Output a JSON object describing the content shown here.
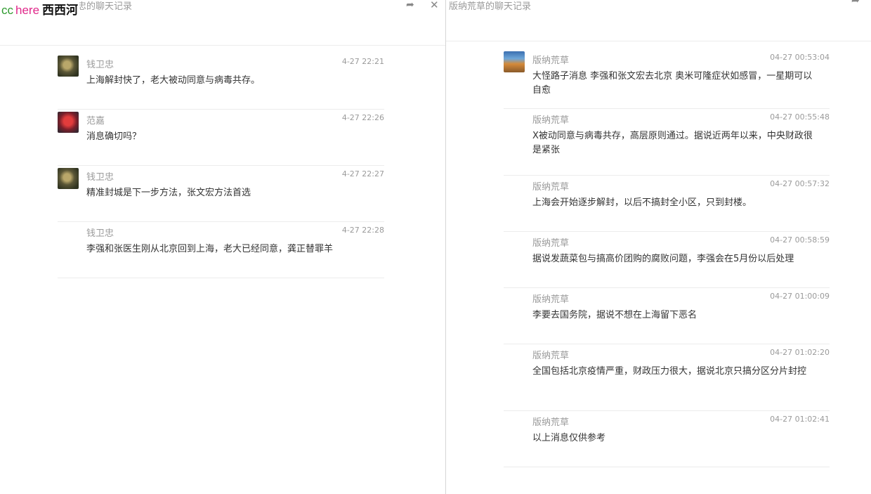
{
  "left": {
    "title": "钱卫忠的聊天记录",
    "title_visible": "忠的聊天记录",
    "watermark": {
      "cc": "cc",
      "here": "here",
      "name": "西西河"
    },
    "icons": {
      "share": "share-icon",
      "close": "close-icon"
    },
    "messages": [
      {
        "sender": "钱卫忠",
        "time": "4-27 22:21",
        "text": "上海解封快了，老大被动同意与病毒共存。",
        "avatar": "avatar-flower-yellow"
      },
      {
        "sender": "范嘉",
        "time": "4-27 22:26",
        "text": "消息确切吗？",
        "avatar": "avatar-flower-red"
      },
      {
        "sender": "钱卫忠",
        "time": "4-27 22:27",
        "text": "精准封城是下一步方法，张文宏方法首选",
        "avatar": "avatar-flower-yellow"
      },
      {
        "sender": "钱卫忠",
        "time": "4-27 22:28",
        "text": "李强和张医生刚从北京回到上海，老大已经同意，龚正替罪羊",
        "avatar": null
      }
    ]
  },
  "right": {
    "title": "版纳荒草的聊天记录",
    "icons": {
      "share": "share-icon"
    },
    "messages": [
      {
        "sender": "版纳荒草",
        "time": "04-27 00:53:04",
        "text": "大怪路子消息    李强和张文宏去北京     奥米可隆症状如感冒，一星期可以自愈",
        "avatar": "avatar-landscape"
      },
      {
        "sender": "版纳荒草",
        "time": "04-27 00:55:48",
        "text": "X被动同意与病毒共存，高层原则通过。据说近两年以来，中央财政很是紧张"
      },
      {
        "sender": "版纳荒草",
        "time": "04-27 00:57:32",
        "text": "上海会开始逐步解封，以后不搞封全小区，只到封楼。"
      },
      {
        "sender": "版纳荒草",
        "time": "04-27 00:58:59",
        "text": "据说发蔬菜包与搞高价团购的腐败问题，李强会在5月份以后处理"
      },
      {
        "sender": "版纳荒草",
        "time": "04-27 01:00:09",
        "text": "李要去国务院，据说不想在上海留下恶名"
      },
      {
        "sender": "版纳荒草",
        "time": "04-27 01:02:20",
        "text": "全国包括北京疫情严重，财政压力很大，据说北京只搞分区分片封控"
      },
      {
        "sender": "版纳荒草",
        "time": "04-27 01:02:41",
        "text": "以上消息仅供参考"
      }
    ]
  }
}
